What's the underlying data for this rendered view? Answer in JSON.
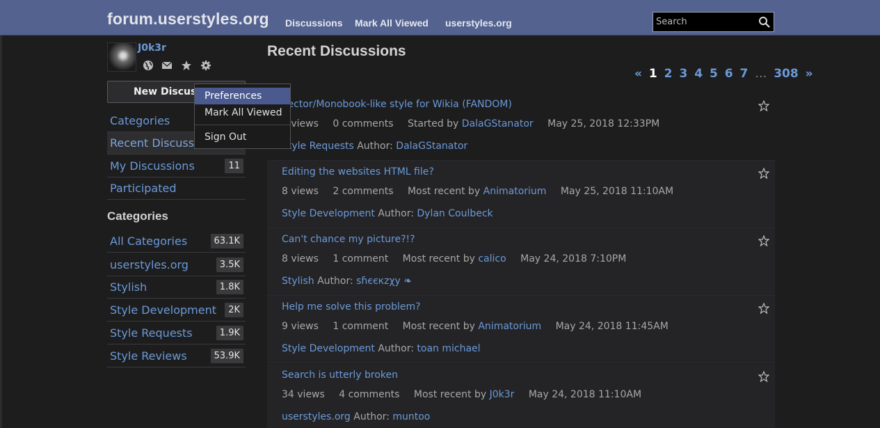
{
  "header": {
    "site_title": "forum.userstyles.org",
    "nav": [
      "Discussions",
      "Mark All Viewed",
      "userstyles.org"
    ],
    "search_placeholder": "Search"
  },
  "user": {
    "name": "J0k3r",
    "icons": [
      "globe-icon",
      "mail-icon",
      "star-icon",
      "gear-icon"
    ]
  },
  "sidebar": {
    "new_discussion": "New Discussion",
    "nav": [
      {
        "label": "Categories",
        "count": ""
      },
      {
        "label": "Recent Discussions",
        "count": ""
      },
      {
        "label": "My Discussions",
        "count": "11"
      },
      {
        "label": "Participated",
        "count": ""
      }
    ],
    "categories_heading": "Categories",
    "categories": [
      {
        "label": "All Categories",
        "count": "63.1K"
      },
      {
        "label": "userstyles.org",
        "count": "3.5K"
      },
      {
        "label": "Stylish",
        "count": "1.8K"
      },
      {
        "label": "Style Development",
        "count": "2K"
      },
      {
        "label": "Style Requests",
        "count": "1.9K"
      },
      {
        "label": "Style Reviews",
        "count": "53.9K"
      }
    ]
  },
  "dropdown": {
    "items": [
      "Preferences",
      "Mark All Viewed",
      "Sign Out"
    ]
  },
  "main": {
    "title": "Recent Discussions",
    "pager": [
      "«",
      "1",
      "2",
      "3",
      "4",
      "5",
      "6",
      "7",
      "…",
      "308",
      "»"
    ],
    "current_page": "1",
    "discussions": [
      {
        "title": "Vector/Monobook-like style for Wikia (FANDOM)",
        "views": "7 views",
        "comments": "0 comments",
        "by_label": "Started by",
        "by": "DalaGStanator",
        "date": "May 25, 2018 12:33PM",
        "category": "Style Requests",
        "author_label": "Author:",
        "author": "DalaGStanator"
      },
      {
        "title": "Editing the websites HTML file?",
        "views": "8 views",
        "comments": "2 comments",
        "by_label": "Most recent by",
        "by": "Animatorium",
        "date": "May 25, 2018 11:10AM",
        "category": "Style Development",
        "author_label": "Author:",
        "author": "Dylan Coulbeck"
      },
      {
        "title": "Can't chance my picture?!?",
        "views": "8 views",
        "comments": "1 comment",
        "by_label": "Most recent by",
        "by": "calico",
        "date": "May 24, 2018 7:10PM",
        "category": "Stylish",
        "author_label": "Author:",
        "author": "sɦєєкzχy ❧"
      },
      {
        "title": "Help me solve this problem?",
        "views": "9 views",
        "comments": "1 comment",
        "by_label": "Most recent by",
        "by": "Animatorium",
        "date": "May 24, 2018 11:45AM",
        "category": "Style Development",
        "author_label": "Author:",
        "author": "toan michael"
      },
      {
        "title": "Search is utterly broken",
        "views": "34 views",
        "comments": "4 comments",
        "by_label": "Most recent by",
        "by": "J0k3r",
        "date": "May 24, 2018 11:10AM",
        "category": "userstyles.org",
        "author_label": "Author:",
        "author": "muntoo"
      }
    ]
  }
}
